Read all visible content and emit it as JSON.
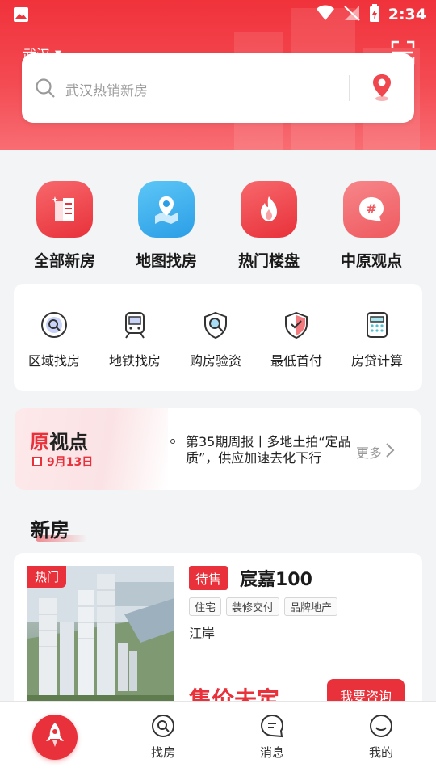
{
  "status_bar": {
    "time": "2:34"
  },
  "header": {
    "city": "武汉",
    "search_placeholder": "武汉热销新房"
  },
  "main_categories": [
    {
      "label": "全部新房",
      "icon": "building-icon",
      "color": "#ee4a4f"
    },
    {
      "label": "地图找房",
      "icon": "map-pin-icon",
      "color": "#36a9ea"
    },
    {
      "label": "热门楼盘",
      "icon": "flame-icon",
      "color": "#ee4a4f"
    },
    {
      "label": "中原观点",
      "icon": "hashtag-icon",
      "color": "#ee6a6d"
    }
  ],
  "sub_categories": [
    {
      "label": "区域找房",
      "icon": "area-search-icon"
    },
    {
      "label": "地铁找房",
      "icon": "subway-icon"
    },
    {
      "label": "购房验资",
      "icon": "shield-search-icon"
    },
    {
      "label": "最低首付",
      "icon": "shield-check-icon"
    },
    {
      "label": "房贷计算",
      "icon": "calculator-icon"
    }
  ],
  "news": {
    "logo_red": "原",
    "logo_rest": "视点",
    "date": "9月13日",
    "headline": "第35期周报丨多地土拍“定品质”，供应加速去化下行",
    "more": "更多"
  },
  "section": {
    "title": "新房"
  },
  "property": {
    "badge": "热门",
    "status": "待售",
    "name": "宸嘉100",
    "tags": [
      "住宅",
      "装修交付",
      "品牌地产"
    ],
    "location": "江岸",
    "price": "售价未定",
    "consult": "我要咨询"
  },
  "bottom_nav": [
    {
      "label": "找房",
      "icon": "search-house-icon"
    },
    {
      "label": "消息",
      "icon": "message-icon"
    },
    {
      "label": "我的",
      "icon": "profile-icon"
    }
  ],
  "colors": {
    "brand_red": "#e8313a",
    "background": "#f3f4f6"
  }
}
